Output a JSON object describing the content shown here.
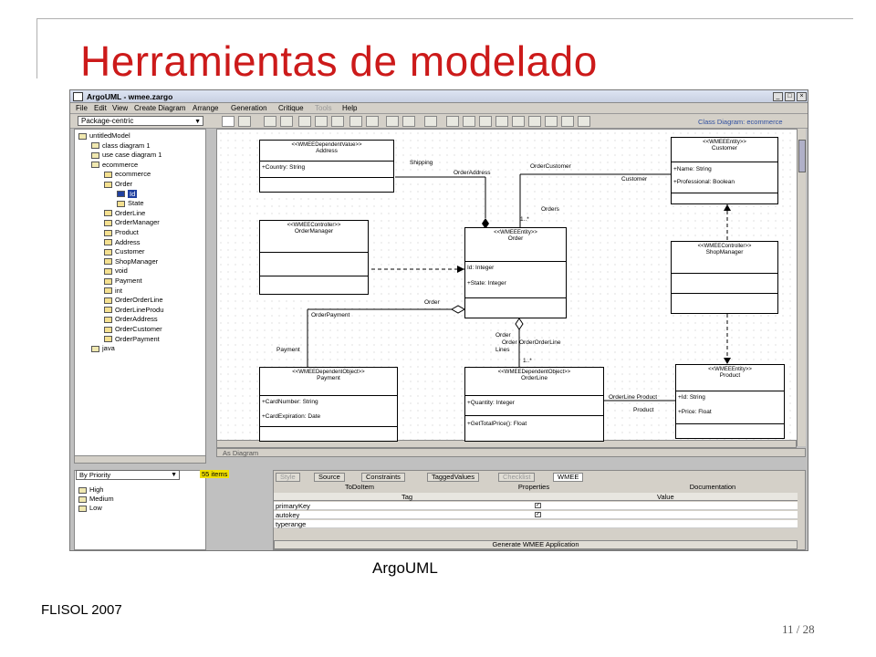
{
  "slide": {
    "title": "Herramientas de modelado",
    "caption": "ArgoUML",
    "footer": "FLISOL 2007",
    "page": "11 / 28"
  },
  "window": {
    "title": "ArgoUML - wmee.zargo",
    "diagram_name": "Class Diagram: ecommerce"
  },
  "menu": [
    "File",
    "Edit",
    "View",
    "Create Diagram",
    "Arrange",
    "Generation",
    "Critique",
    "Tools",
    "Help"
  ],
  "navigator": {
    "perspective": "Package-centric",
    "tree": [
      {
        "label": "untitledModel",
        "depth": 0
      },
      {
        "label": "class diagram 1",
        "depth": 1
      },
      {
        "label": "use case diagram 1",
        "depth": 1
      },
      {
        "label": "ecommerce",
        "depth": 1
      },
      {
        "label": "ecommerce",
        "depth": 2
      },
      {
        "label": "Order",
        "depth": 2
      },
      {
        "label": "Id",
        "depth": 3
      },
      {
        "label": "State",
        "depth": 3
      },
      {
        "label": "OrderLine",
        "depth": 2
      },
      {
        "label": "OrderManager",
        "depth": 2
      },
      {
        "label": "Product",
        "depth": 2
      },
      {
        "label": "Address",
        "depth": 2
      },
      {
        "label": "Customer",
        "depth": 2
      },
      {
        "label": "ShopManager",
        "depth": 2
      },
      {
        "label": "void",
        "depth": 2
      },
      {
        "label": "Payment",
        "depth": 2
      },
      {
        "label": "int",
        "depth": 2
      },
      {
        "label": "OrderOrderLine",
        "depth": 2
      },
      {
        "label": "OrderLineProdu",
        "depth": 2
      },
      {
        "label": "OrderAddress",
        "depth": 2
      },
      {
        "label": "OrderCustomer",
        "depth": 2
      },
      {
        "label": "OrderPayment",
        "depth": 2
      },
      {
        "label": "java",
        "depth": 1
      }
    ]
  },
  "classes": {
    "address": {
      "stereotype": "<<WMEEDependentValue>>",
      "name": "Address",
      "attrs": [
        "+Country: String"
      ]
    },
    "customer": {
      "stereotype": "<<WMEEEntity>>",
      "name": "Customer",
      "attrs": [
        "+Name: String",
        "+Professional: Boolean"
      ]
    },
    "ordermanager": {
      "stereotype": "<<WMEEController>>",
      "name": "OrderManager",
      "attrs": []
    },
    "order": {
      "stereotype": "<<WMEEEntity>>",
      "name": "Order",
      "attrs": [
        "Id: Integer",
        "+State: Integer"
      ]
    },
    "shopmanager": {
      "stereotype": "<<WMEEController>>",
      "name": "ShopManager",
      "attrs": []
    },
    "payment": {
      "stereotype": "<<WMEEDependentObject>>",
      "name": "Payment",
      "attrs": [
        "+CardNumber: String",
        "+CardExpiration: Date"
      ]
    },
    "orderline": {
      "stereotype": "<<WMEEDependentObject>>",
      "name": "OrderLine",
      "attrs": [
        "+Quantity: Integer",
        "+GetTotalPrice(): Float"
      ]
    },
    "product": {
      "stereotype": "<<WMEEEntity>>",
      "name": "Product",
      "attrs": [
        "+Id: String",
        "+Price: Float"
      ]
    }
  },
  "edge_labels": {
    "shipping": "Shipping",
    "order_address": "OrderAddress",
    "order_customer": "OrderCustomer",
    "customer": "Customer",
    "orders": "Orders",
    "mult_1": "1..*",
    "order": "Order",
    "order_payment": "OrderPayment",
    "payment": "Payment",
    "order2": "Order",
    "order_orderline": "OrderOrderLine",
    "order_orderline_1": "Order",
    "order_orderline_2": "Lines",
    "mult_2": "1..*",
    "orderline_product": "OrderLine Product",
    "product": "Product"
  },
  "diagram_tab": "As Diagram",
  "todo": {
    "grouping": "By Priority",
    "count": "55 items",
    "items": [
      "High",
      "Medium",
      "Low"
    ]
  },
  "details": {
    "tabs": [
      "Style",
      "Source",
      "Constraints",
      "TaggedValues",
      "Checklist",
      "WMEE"
    ],
    "subtabs": [
      "ToDoItem",
      "Properties",
      "Documentation"
    ],
    "columns": [
      "Tag",
      "Value"
    ],
    "rows": [
      "primaryKey",
      "autokey",
      "typerange"
    ],
    "generate_button": "Generate WMEE Application"
  }
}
